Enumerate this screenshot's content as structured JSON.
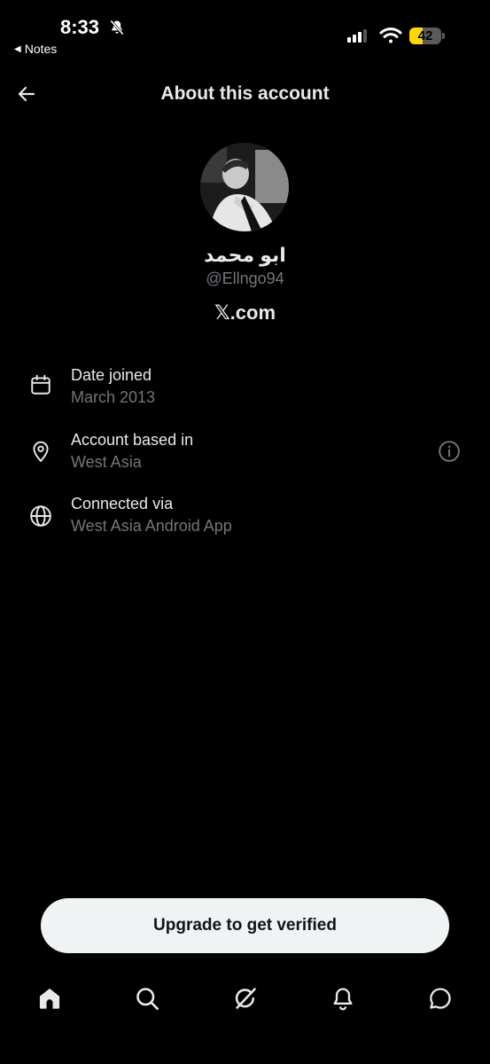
{
  "status_bar": {
    "time": "8:33",
    "back_app": "Notes",
    "battery": "42",
    "battery_level": 0.42,
    "silent_icon": "bell-slash-icon",
    "signal_icon": "cellular-signal-icon",
    "wifi_icon": "wifi-icon"
  },
  "header": {
    "title": "About this account",
    "back_icon": "arrow-left-icon"
  },
  "profile": {
    "display_name": "ابو محمد",
    "handle": "@Ellngo94",
    "site": "𝕏.com"
  },
  "info": [
    {
      "icon": "calendar-icon",
      "title": "Date joined",
      "value": "March 2013"
    },
    {
      "icon": "location-pin-icon",
      "title": "Account based in",
      "value": "West Asia",
      "action_icon": "info-circle-icon"
    },
    {
      "icon": "globe-icon",
      "title": "Connected via",
      "value": "West Asia Android App"
    }
  ],
  "upgrade": {
    "label": "Upgrade to get verified"
  },
  "nav": [
    "home-icon",
    "search-icon",
    "grok-icon",
    "notifications-icon",
    "messages-icon"
  ],
  "colors": {
    "background": "#000000",
    "text": "#e7e9ea",
    "secondary": "#71767b",
    "button_bg": "#eff3f4",
    "battery": "#ffd60a"
  }
}
